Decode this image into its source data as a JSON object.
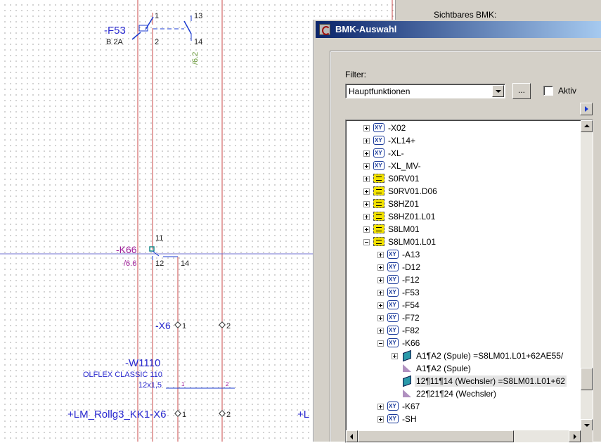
{
  "schematic": {
    "f53": {
      "name": "-F53",
      "rating": "B 2A",
      "t1": "1",
      "t2": "2",
      "t13": "13",
      "t14": "14",
      "ref": "/6.2"
    },
    "k66": {
      "name": "-K66",
      "ref": "/6.6",
      "t11": "11",
      "t12": "12",
      "t14": "14"
    },
    "x6": {
      "name": "-X6",
      "p1": "1",
      "p2": "2"
    },
    "w1110": {
      "name": "-W1110",
      "type": "OLFLEX CLASSIC 110",
      "size": "12x1,5",
      "c1": "1",
      "c2": "2"
    },
    "lm": {
      "name": "+LM_Rollg3_KK1-X6",
      "p1": "1",
      "p2": "2",
      "partial": "+L"
    }
  },
  "background_dialog": {
    "visible_label": "Sichtbares BMK:"
  },
  "dialog": {
    "title": "BMK-Auswahl",
    "filter_label": "Filter:",
    "filter_value": "Hauptfunktionen",
    "more_button": "...",
    "aktiv_label": "Aktiv",
    "tree": [
      {
        "indent": 0,
        "expander": "plus",
        "icon": "xy",
        "label": "-X02"
      },
      {
        "indent": 0,
        "expander": "plus",
        "icon": "xy",
        "label": "-XL14+"
      },
      {
        "indent": 0,
        "expander": "plus",
        "icon": "xy",
        "label": "-XL-"
      },
      {
        "indent": 0,
        "expander": "plus",
        "icon": "xy",
        "label": "-XL_MV-"
      },
      {
        "indent": 0,
        "expander": "plus",
        "icon": "eq",
        "label": "S0RV01"
      },
      {
        "indent": 0,
        "expander": "plus",
        "icon": "eq",
        "label": "S0RV01.D06"
      },
      {
        "indent": 0,
        "expander": "plus",
        "icon": "eq",
        "label": "S8HZ01"
      },
      {
        "indent": 0,
        "expander": "plus",
        "icon": "eq",
        "label": "S8HZ01.L01"
      },
      {
        "indent": 0,
        "expander": "plus",
        "icon": "eq",
        "label": "S8LM01"
      },
      {
        "indent": 0,
        "expander": "minus",
        "icon": "eq",
        "label": "S8LM01.L01"
      },
      {
        "indent": 1,
        "expander": "plus",
        "icon": "xy",
        "label": "-A13"
      },
      {
        "indent": 1,
        "expander": "plus",
        "icon": "xy",
        "label": "-D12"
      },
      {
        "indent": 1,
        "expander": "plus",
        "icon": "xy",
        "label": "-F12"
      },
      {
        "indent": 1,
        "expander": "plus",
        "icon": "xy",
        "label": "-F53"
      },
      {
        "indent": 1,
        "expander": "plus",
        "icon": "xy",
        "label": "-F54"
      },
      {
        "indent": 1,
        "expander": "plus",
        "icon": "xy",
        "label": "-F72"
      },
      {
        "indent": 1,
        "expander": "plus",
        "icon": "xy",
        "label": "-F82"
      },
      {
        "indent": 1,
        "expander": "minus",
        "icon": "xy",
        "label": "-K66"
      },
      {
        "indent": 2,
        "expander": "plus",
        "icon": "func",
        "label": "A1¶A2 (Spule) =S8LM01.L01+62AE55/"
      },
      {
        "indent": 2,
        "expander": "none",
        "icon": "tri",
        "label": "A1¶A2 (Spule)"
      },
      {
        "indent": 2,
        "expander": "none",
        "icon": "func",
        "label": "12¶11¶14 (Wechsler) =S8LM01.L01+62",
        "selected": true
      },
      {
        "indent": 2,
        "expander": "none",
        "icon": "tri",
        "label": "22¶21¶24 (Wechsler)"
      },
      {
        "indent": 1,
        "expander": "plus",
        "icon": "xy",
        "label": "-K67"
      },
      {
        "indent": 1,
        "expander": "plus",
        "icon": "xy",
        "label": "-SH"
      }
    ]
  }
}
